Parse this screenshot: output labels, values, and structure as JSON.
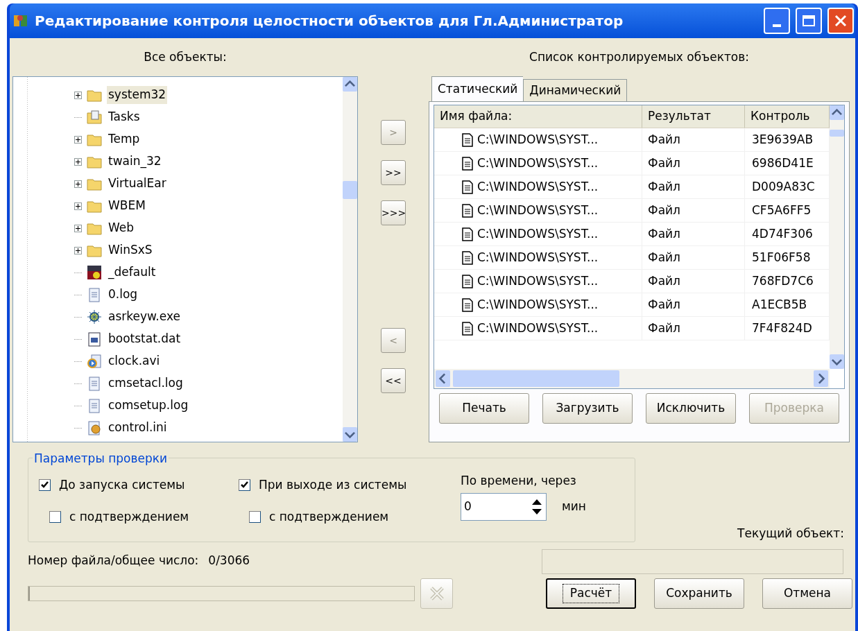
{
  "window": {
    "title": "Редактирование контроля целостности объектов для Гл.Администратор"
  },
  "tree": {
    "label": "Все объекты:",
    "items": [
      {
        "label": "system32",
        "kind": "folder",
        "expandable": true,
        "selected": true
      },
      {
        "label": "Tasks",
        "kind": "special-folder",
        "expandable": false,
        "selected": false
      },
      {
        "label": "Temp",
        "kind": "folder",
        "expandable": true,
        "selected": false
      },
      {
        "label": "twain_32",
        "kind": "folder",
        "expandable": true,
        "selected": false
      },
      {
        "label": "VirtualEar",
        "kind": "folder",
        "expandable": true,
        "selected": false
      },
      {
        "label": "WBEM",
        "kind": "folder",
        "expandable": true,
        "selected": false
      },
      {
        "label": "Web",
        "kind": "folder",
        "expandable": true,
        "selected": false
      },
      {
        "label": "WinSxS",
        "kind": "folder",
        "expandable": true,
        "selected": false
      },
      {
        "label": "_default",
        "kind": "media",
        "expandable": false,
        "selected": false
      },
      {
        "label": "0.log",
        "kind": "text",
        "expandable": false,
        "selected": false
      },
      {
        "label": "asrkeyw.exe",
        "kind": "program",
        "expandable": false,
        "selected": false
      },
      {
        "label": "bootstat.dat",
        "kind": "data",
        "expandable": false,
        "selected": false
      },
      {
        "label": "clock.avi",
        "kind": "video",
        "expandable": false,
        "selected": false
      },
      {
        "label": "cmsetacl.log",
        "kind": "text",
        "expandable": false,
        "selected": false
      },
      {
        "label": "comsetup.log",
        "kind": "text",
        "expandable": false,
        "selected": false
      },
      {
        "label": "control.ini",
        "kind": "settings",
        "expandable": false,
        "selected": false
      }
    ]
  },
  "transfer_buttons": [
    {
      "label": ">",
      "disabled": true
    },
    {
      "label": ">>",
      "disabled": false
    },
    {
      "label": ">>>",
      "disabled": false
    },
    {
      "label": "<",
      "disabled": true
    },
    {
      "label": "<<",
      "disabled": false
    }
  ],
  "controlled": {
    "label": "Список контролируемых объектов:",
    "tabs": [
      {
        "label": "Статический",
        "selected": true
      },
      {
        "label": "Динамический",
        "selected": false
      }
    ],
    "table": {
      "columns": [
        "Имя файла:",
        "Результат",
        "Контроль"
      ],
      "rows": [
        [
          "C:\\WINDOWS\\SYST...",
          "Файл",
          "3E9639AB"
        ],
        [
          "C:\\WINDOWS\\SYST...",
          "Файл",
          "6986D41E"
        ],
        [
          "C:\\WINDOWS\\SYST...",
          "Файл",
          "D009A83C"
        ],
        [
          "C:\\WINDOWS\\SYST...",
          "Файл",
          "CF5A6FF5"
        ],
        [
          "C:\\WINDOWS\\SYST...",
          "Файл",
          "4D74F306"
        ],
        [
          "C:\\WINDOWS\\SYST...",
          "Файл",
          "51F06F58"
        ],
        [
          "C:\\WINDOWS\\SYST...",
          "Файл",
          "768FD7C6"
        ],
        [
          "C:\\WINDOWS\\SYST...",
          "Файл",
          "A1ECB5B"
        ],
        [
          "C:\\WINDOWS\\SYST...",
          "Файл",
          "7F4F824D"
        ]
      ]
    },
    "buttons": [
      {
        "label": "Печать",
        "disabled": false
      },
      {
        "label": "Загрузить",
        "disabled": false
      },
      {
        "label": "Исключить",
        "disabled": false
      },
      {
        "label": "Проверка",
        "disabled": true
      }
    ]
  },
  "params": {
    "title": "Параметры проверки",
    "checks": [
      {
        "label": "До запуска системы",
        "checked": true
      },
      {
        "label": "При выходе из системы",
        "checked": true
      },
      {
        "label": "с подтверждением",
        "checked": false
      },
      {
        "label": "с подтверждением",
        "checked": false
      }
    ],
    "timer_label": "По времени, через",
    "timer_value": "0",
    "timer_unit": "мин"
  },
  "current_object": {
    "label": "Текущий объект:"
  },
  "progress": {
    "label": "Номер файла/общее число:",
    "count": "0/3066",
    "level": 0
  },
  "buttons": [
    {
      "label": "Расчёт",
      "default": true
    },
    {
      "label": "Сохранить",
      "default": false
    },
    {
      "label": "Отмена",
      "default": false
    }
  ]
}
